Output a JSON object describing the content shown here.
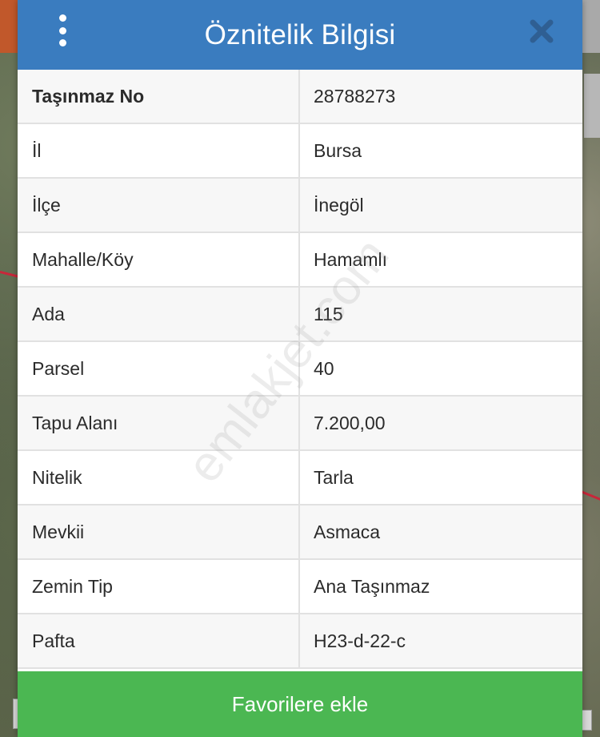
{
  "dialog": {
    "title": "Öznitelik Bilgisi",
    "menu_icon": "more-vertical-icon",
    "close_icon": "close-icon"
  },
  "attributes": [
    {
      "key": "Taşınmaz No",
      "value": "28788273"
    },
    {
      "key": "İl",
      "value": "Bursa"
    },
    {
      "key": "İlçe",
      "value": "İnegöl"
    },
    {
      "key": "Mahalle/Köy",
      "value": "Hamamlı"
    },
    {
      "key": "Ada",
      "value": "115"
    },
    {
      "key": "Parsel",
      "value": "40"
    },
    {
      "key": "Tapu Alanı",
      "value": "7.200,00"
    },
    {
      "key": "Nitelik",
      "value": "Tarla"
    },
    {
      "key": "Mevkii",
      "value": "Asmaca"
    },
    {
      "key": "Zemin Tip",
      "value": "Ana Taşınmaz"
    },
    {
      "key": "Pafta",
      "value": "H23-d-22-c"
    }
  ],
  "footer": {
    "favorite_label": "Favorilere ekle"
  },
  "watermark": "emlakjet.com",
  "colors": {
    "header": "#3a7cbf",
    "favorite_button": "#4bb752",
    "map_line": "#c8273a"
  }
}
